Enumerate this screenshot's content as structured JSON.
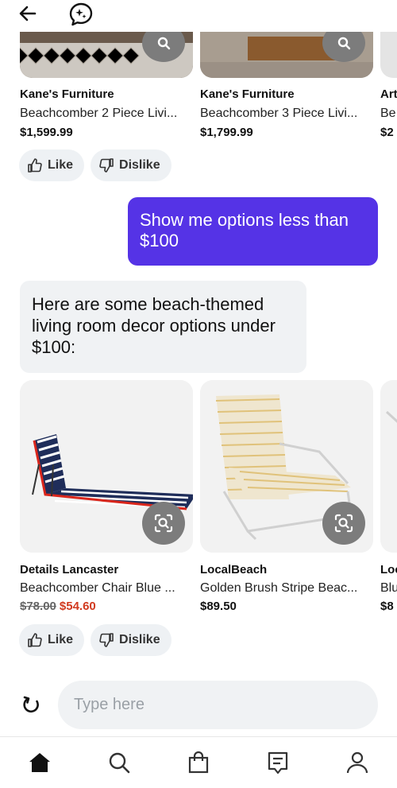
{
  "top_bar": {
    "back_icon": "arrow-left-icon",
    "chat_icon": "sparkle-chat-icon"
  },
  "carousel_top": {
    "items": [
      {
        "store": "Kane's Furniture",
        "title": "Beachcomber 2 Piece Livi...",
        "price": "$1,599.99"
      },
      {
        "store": "Kane's Furniture",
        "title": "Beachcomber 3 Piece Livi...",
        "price": "$1,799.99"
      },
      {
        "store": "Art",
        "title": "Be",
        "price": "$2"
      }
    ]
  },
  "reactions_top": {
    "like": "Like",
    "dislike": "Dislike"
  },
  "messages": {
    "user": "Show me options less than $100",
    "bot": "Here are some beach-themed living room decor options under $100:"
  },
  "carousel_bottom": {
    "items": [
      {
        "store": "Details Lancaster",
        "title": "Beachcomber Chair Blue ...",
        "price_old": "$78.00",
        "price_sale": "$54.60"
      },
      {
        "store": "LocalBeach",
        "title": "Golden Brush Stripe Beac...",
        "price": "$89.50"
      },
      {
        "store": "Loc",
        "title": "Blu",
        "price": "$8"
      }
    ]
  },
  "reactions_bottom": {
    "like": "Like",
    "dislike": "Dislike"
  },
  "composer": {
    "placeholder": "Type here"
  },
  "bottom_nav": [
    "home-icon",
    "search-icon",
    "shopping-bag-icon",
    "lists-icon",
    "profile-icon"
  ],
  "colors": {
    "accent": "#5533e6",
    "sale": "#d13a1f",
    "bubble_bg": "#f0f2f4"
  }
}
